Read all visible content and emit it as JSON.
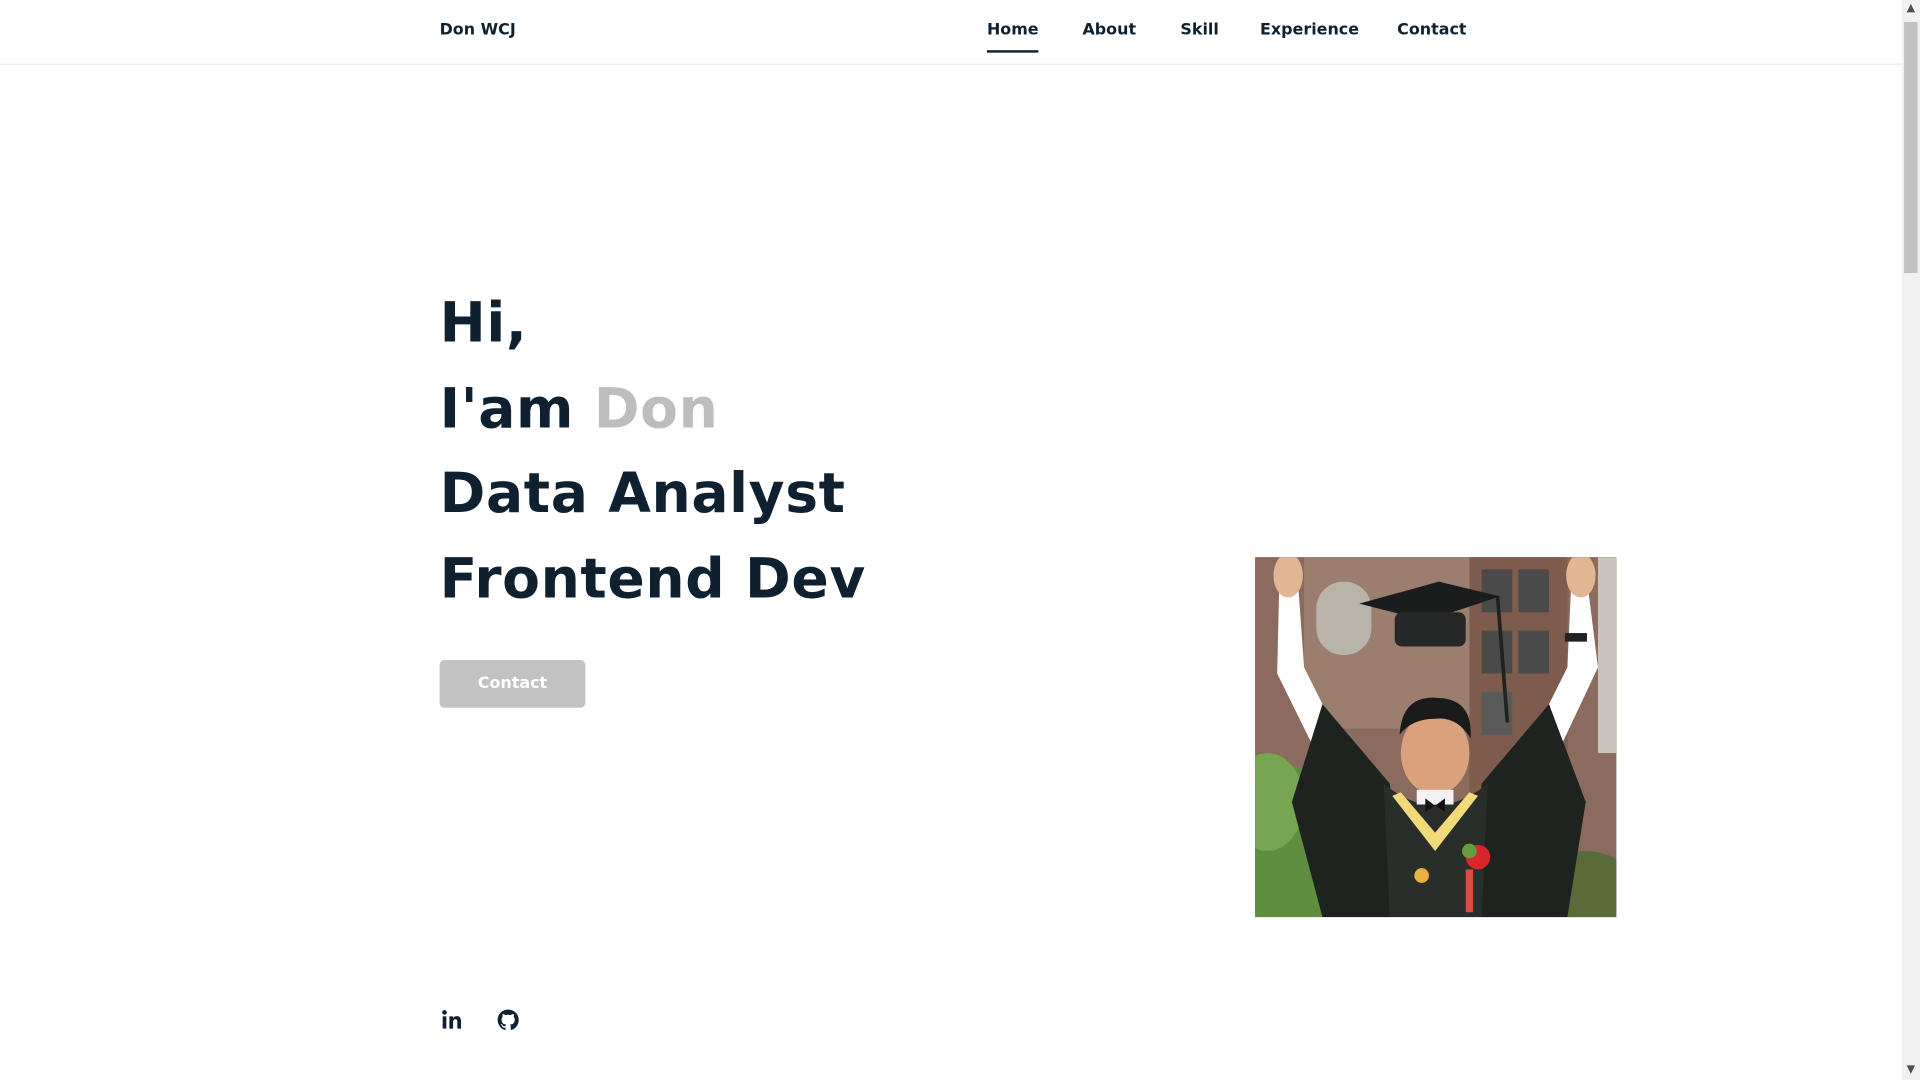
{
  "header": {
    "logo": "Don WCJ",
    "nav": [
      {
        "label": "Home",
        "active": true
      },
      {
        "label": "About",
        "active": false
      },
      {
        "label": "Skill",
        "active": false
      },
      {
        "label": "Experience",
        "active": false
      },
      {
        "label": "Contact",
        "active": false
      }
    ]
  },
  "hero": {
    "line1": "Hi,",
    "line2_prefix": "I'am ",
    "line2_name": "Don",
    "line3": "Data Analyst",
    "line4": "Frontend Dev",
    "button_label": "Contact"
  },
  "social": {
    "linkedin_icon": "in",
    "github_icon": "github-icon"
  },
  "colors": {
    "text": "#0f2130",
    "accent_name": "#bdbdbd",
    "button_bg": "#c2c2c2"
  }
}
